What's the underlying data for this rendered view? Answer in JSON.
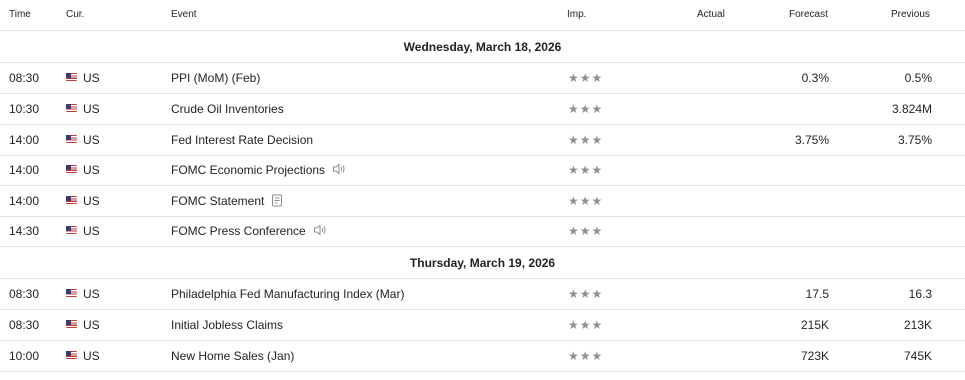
{
  "header": {
    "time": "Time",
    "currency": "Cur.",
    "event": "Event",
    "importance": "Imp.",
    "actual": "Actual",
    "forecast": "Forecast",
    "previous": "Previous"
  },
  "groups": [
    {
      "date": "Wednesday, March 18, 2026",
      "rows": [
        {
          "time": "08:30",
          "currency": "US",
          "event": "PPI (MoM) (Feb)",
          "importance": "★★★",
          "importance_level": 3,
          "actual": "",
          "forecast": "0.3%",
          "previous": "0.5%",
          "icon": ""
        },
        {
          "time": "10:30",
          "currency": "US",
          "event": "Crude Oil Inventories",
          "importance": "★★★",
          "importance_level": 3,
          "actual": "",
          "forecast": "",
          "previous": "3.824M",
          "icon": ""
        },
        {
          "time": "14:00",
          "currency": "US",
          "event": "Fed Interest Rate Decision",
          "importance": "★★★",
          "importance_level": 3,
          "actual": "",
          "forecast": "3.75%",
          "previous": "3.75%",
          "icon": ""
        },
        {
          "time": "14:00",
          "currency": "US",
          "event": "FOMC Economic Projections",
          "importance": "★★★",
          "importance_level": 3,
          "actual": "",
          "forecast": "",
          "previous": "",
          "icon": "speaker-icon"
        },
        {
          "time": "14:00",
          "currency": "US",
          "event": "FOMC Statement",
          "importance": "★★★",
          "importance_level": 3,
          "actual": "",
          "forecast": "",
          "previous": "",
          "icon": "document-icon"
        },
        {
          "time": "14:30",
          "currency": "US",
          "event": "FOMC Press Conference",
          "importance": "★★★",
          "importance_level": 3,
          "actual": "",
          "forecast": "",
          "previous": "",
          "icon": "speaker-icon"
        }
      ]
    },
    {
      "date": "Thursday, March 19, 2026",
      "rows": [
        {
          "time": "08:30",
          "currency": "US",
          "event": "Philadelphia Fed Manufacturing Index (Mar)",
          "importance": "★★★",
          "importance_level": 3,
          "actual": "",
          "forecast": "17.5",
          "previous": "16.3",
          "icon": ""
        },
        {
          "time": "08:30",
          "currency": "US",
          "event": "Initial Jobless Claims",
          "importance": "★★★",
          "importance_level": 3,
          "actual": "",
          "forecast": "215K",
          "previous": "213K",
          "icon": ""
        },
        {
          "time": "10:00",
          "currency": "US",
          "event": "New Home Sales (Jan)",
          "importance": "★★★",
          "importance_level": 3,
          "actual": "",
          "forecast": "723K",
          "previous": "745K",
          "icon": ""
        }
      ]
    }
  ],
  "colors": {
    "row_border": "#e3e5e8",
    "star": "#8d9196",
    "text": "#232323"
  }
}
